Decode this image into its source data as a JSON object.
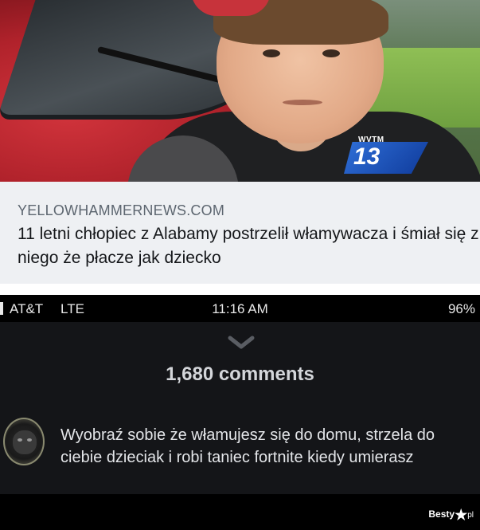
{
  "news_photo": {
    "channel_logo": {
      "brand": "WVTM",
      "number": "13"
    }
  },
  "article": {
    "source": "YELLOWHAMMERNEWS.COM",
    "title": "11 letni chłopiec z Alabamy postrzelił włamywacza i śmiał się z niego że płacze jak dziecko"
  },
  "status_bar": {
    "carrier": "AT&T",
    "network": "LTE",
    "time": "11:16 AM",
    "battery": "96%"
  },
  "comments_panel": {
    "count_label": "1,680 comments",
    "comment": {
      "text": "Wyobraź sobie że włamujesz się do domu, strzela do ciebie dzieciak i robi taniec fortnite kiedy umierasz"
    }
  },
  "watermark": {
    "brand": "Besty",
    "suffix": "pl"
  },
  "colors": {
    "headline_bg": "#eef0f3",
    "comments_bg": "#141518",
    "logo_blue": "#2f6fd8"
  }
}
